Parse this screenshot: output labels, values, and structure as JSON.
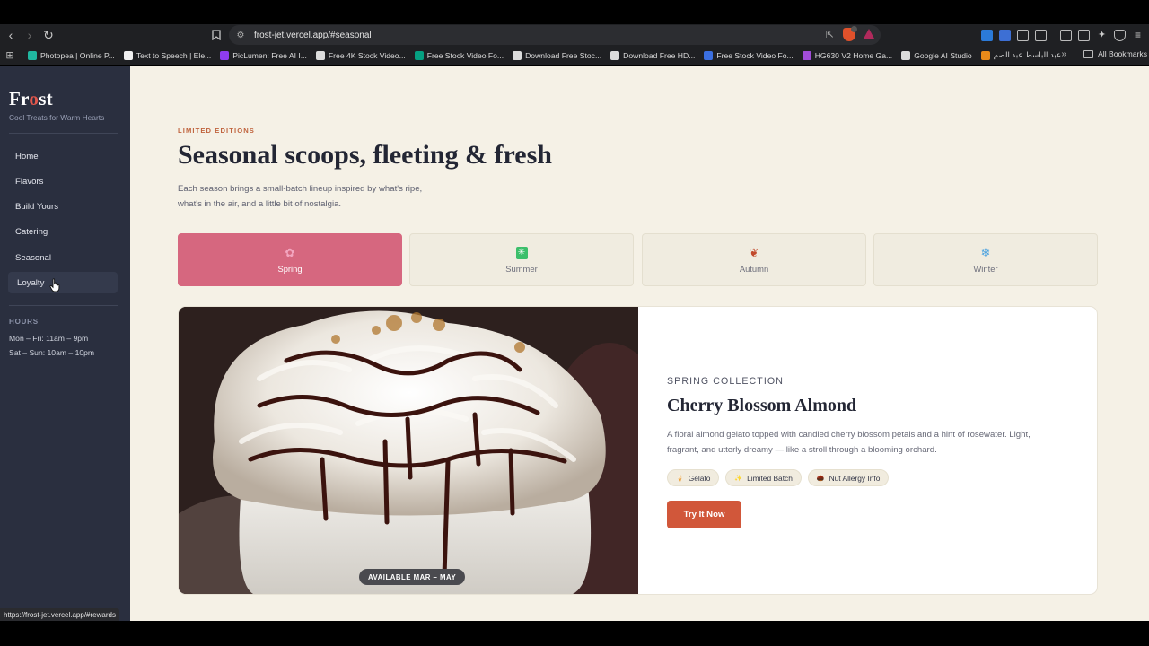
{
  "browser": {
    "url": "frost-jet.vercel.app/#seasonal",
    "bookmarks": [
      {
        "label": "Photopea | Online P...",
        "color": "#20b7a0"
      },
      {
        "label": "Text to Speech | Ele...",
        "color": "#f0f0f0"
      },
      {
        "label": "PicLumen: Free AI I...",
        "color": "#8e3cf0"
      },
      {
        "label": "Free 4K Stock Video...",
        "color": "#dcdcdc"
      },
      {
        "label": "Free Stock Video Fo...",
        "color": "#05a081"
      },
      {
        "label": "Download Free Stoc...",
        "color": "#dcdcdc"
      },
      {
        "label": "Download Free HD...",
        "color": "#dcdcdc"
      },
      {
        "label": "Free Stock Video Fo...",
        "color": "#3b6fe0"
      },
      {
        "label": "HG630 V2 Home Ga...",
        "color": "#a14cd8"
      },
      {
        "label": "Google AI Studio",
        "color": "#dcdcdc"
      },
      {
        "label": "عبد الباسط عبد الصم...",
        "color": "#e88a1a"
      }
    ],
    "all_bookmarks": "All Bookmarks",
    "status_url": "https://frost-jet.vercel.app/#rewards"
  },
  "sidebar": {
    "logo_prefix": "Fr",
    "logo_accent": "o",
    "logo_suffix": "st",
    "tagline": "Cool Treats for Warm Hearts",
    "nav": [
      {
        "label": "Home"
      },
      {
        "label": "Flavors"
      },
      {
        "label": "Build Yours"
      },
      {
        "label": "Catering"
      },
      {
        "label": "Seasonal"
      },
      {
        "label": "Loyalty",
        "hovered": true
      }
    ],
    "hours_label": "HOURS",
    "hours": [
      "Mon – Fri: 11am – 9pm",
      "Sat – Sun: 10am – 10pm"
    ]
  },
  "main": {
    "eyebrow": "LIMITED EDITIONS",
    "headline": "Seasonal scoops, fleeting & fresh",
    "lede": "Each season brings a small-batch lineup inspired by what's ripe, what's in the air, and a little bit of nostalgia.",
    "seasons": [
      {
        "label": "Spring",
        "icon": "cherry-blossom-icon",
        "glyph": "✿",
        "active": true
      },
      {
        "label": "Summer",
        "icon": "sun-icon",
        "glyph": "✳",
        "active": false
      },
      {
        "label": "Autumn",
        "icon": "leaf-icon",
        "glyph": "❦",
        "active": false
      },
      {
        "label": "Winter",
        "icon": "snowflake-icon",
        "glyph": "❄",
        "active": false
      }
    ],
    "feature": {
      "availability": "AVAILABLE MAR – MAY",
      "eyebrow": "SPRING COLLECTION",
      "title": "Cherry Blossom Almond",
      "description": "A floral almond gelato topped with candied cherry blossom petals and a hint of rosewater. Light, fragrant, and utterly dreamy — like a stroll through a blooming orchard.",
      "chips": [
        {
          "label": "Gelato",
          "glyph": "🍦"
        },
        {
          "label": "Limited Batch",
          "glyph": "✨"
        },
        {
          "label": "Nut Allergy Info",
          "glyph": "🌰"
        }
      ],
      "cta": "Try It Now"
    }
  },
  "colors": {
    "accent": "#d1573a",
    "spring_active": "#d6677f",
    "sidebar_bg": "#2a2f3f",
    "page_bg": "#f5f1e6"
  }
}
